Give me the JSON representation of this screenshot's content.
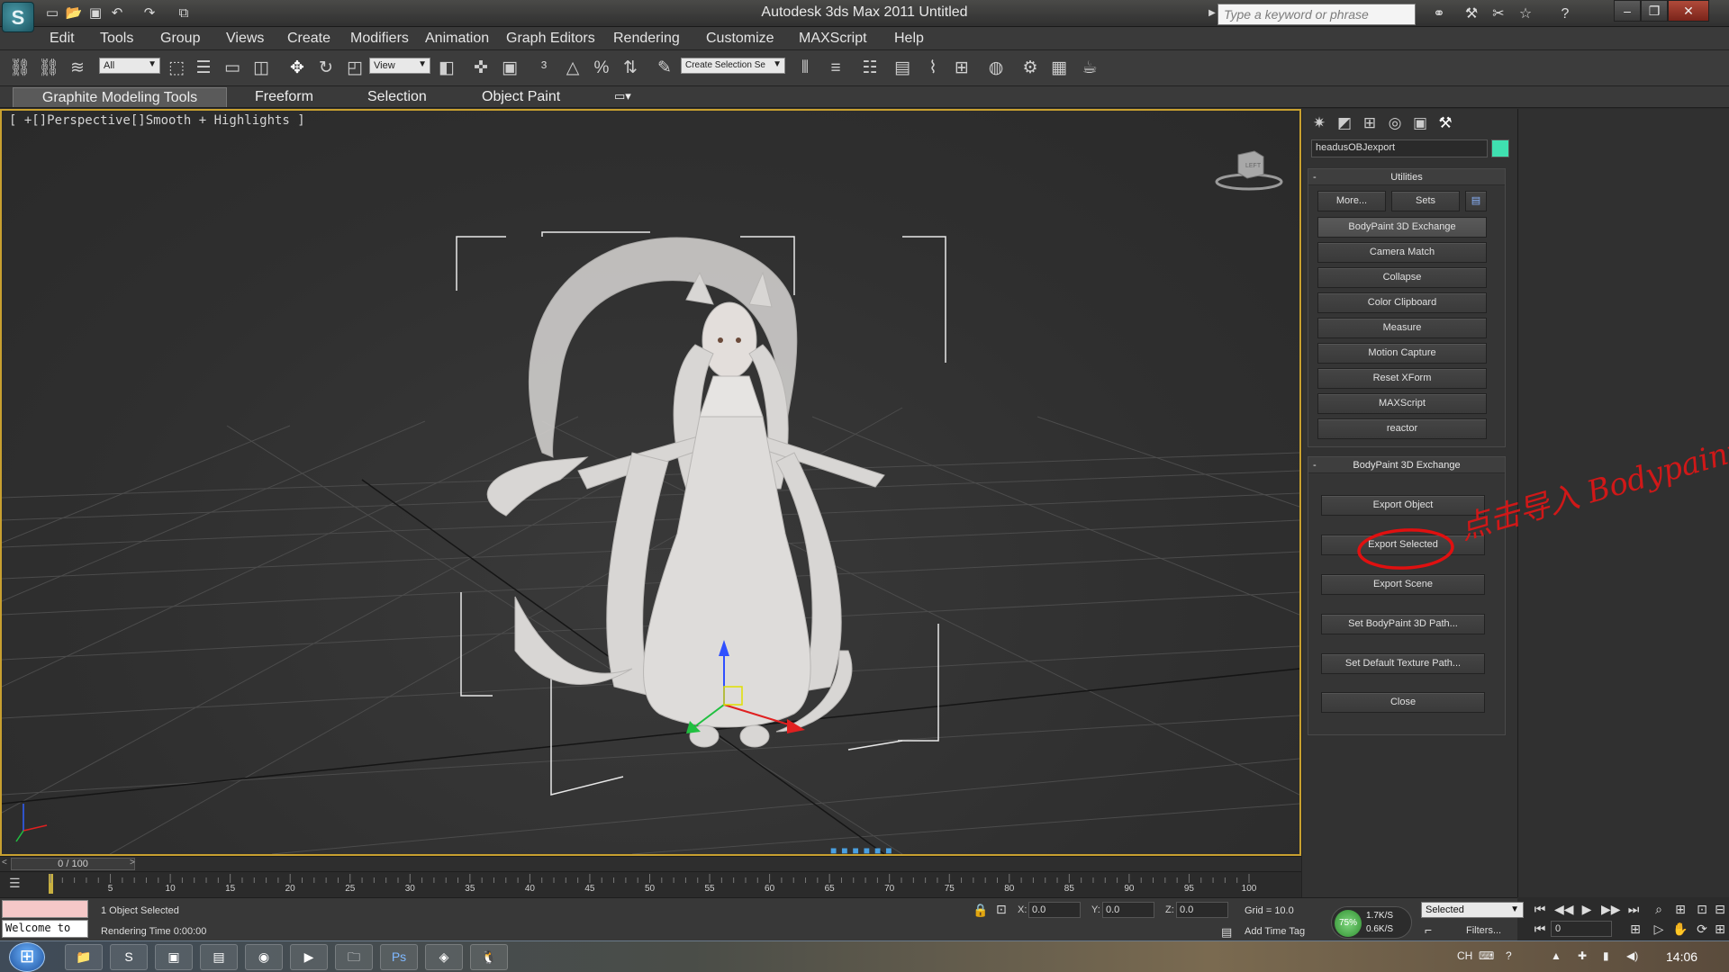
{
  "window": {
    "title": "Autodesk 3ds Max  2011      Untitled",
    "search_placeholder": "Type a keyword or phrase"
  },
  "menu": [
    "Edit",
    "Tools",
    "Group",
    "Views",
    "Create",
    "Modifiers",
    "Animation",
    "Graph Editors",
    "Rendering",
    "Customize",
    "MAXScript",
    "Help"
  ],
  "toolbar": {
    "selection_filter": "All",
    "coord_system": "View",
    "named_selection_placeholder": "Create Selection Se"
  },
  "ribbon": {
    "tabs": [
      "Graphite Modeling Tools",
      "Freeform",
      "Selection",
      "Object Paint"
    ]
  },
  "viewport": {
    "label": "[ +[]Perspective[]Smooth + Highlights ]",
    "viewcube_label": "LEFT"
  },
  "command_panel": {
    "object_name": "headusOBJexport",
    "object_color": "#3fe0b0",
    "utilities_title": "Utilities",
    "more_label": "More...",
    "sets_label": "Sets",
    "utilities": [
      "BodyPaint 3D Exchange",
      "Camera Match",
      "Collapse",
      "Color Clipboard",
      "Measure",
      "Motion Capture",
      "Reset XForm",
      "MAXScript",
      "reactor"
    ],
    "exchange_title": "BodyPaint 3D Exchange",
    "exchange_buttons": [
      "Export Object",
      "Export Selected",
      "Export Scene",
      "Set BodyPaint 3D Path...",
      "Set Default Texture Path...",
      "Close"
    ],
    "annotation_text": "点击导入 Bodypaint"
  },
  "timeline": {
    "position": "0 / 100",
    "ticks": [
      "5",
      "10",
      "15",
      "20",
      "25",
      "30",
      "35",
      "40",
      "45",
      "50",
      "55",
      "60",
      "65",
      "70",
      "75",
      "80",
      "85",
      "90",
      "95",
      "100"
    ]
  },
  "status": {
    "listener_text": "Welcome to",
    "selection_info": "1 Object Selected",
    "rendering_time": "Rendering Time  0:00:00",
    "x_label": "X:",
    "x_value": "0.0",
    "y_label": "Y:",
    "y_value": "0.0",
    "z_label": "Z:",
    "z_value": "0.0",
    "grid": "Grid = 10.0",
    "add_time_tag": "Add Time Tag",
    "net_percent": "75%",
    "net_up": "1.7K/S",
    "net_down": "0.6K/S",
    "key_filter": "Selected",
    "filters_label": "Filters...",
    "frame_value": "0"
  },
  "taskbar": {
    "clock": "14:06",
    "lang": "CH"
  }
}
